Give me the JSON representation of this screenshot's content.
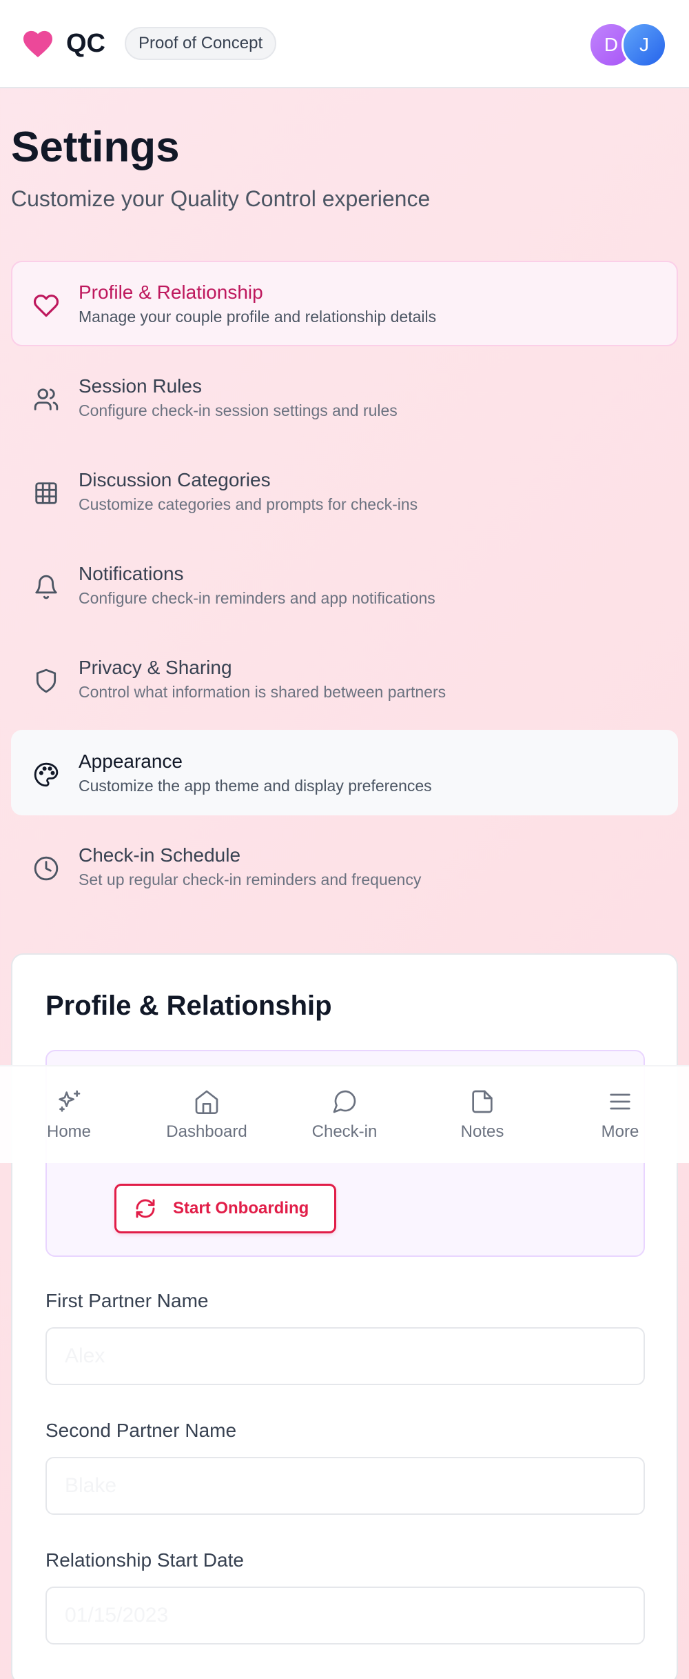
{
  "header": {
    "app_name": "QC",
    "badge": "Proof of Concept",
    "avatars": [
      "D",
      "J"
    ],
    "brand_color": "#ec4899"
  },
  "page": {
    "title": "Settings",
    "subtitle": "Customize your Quality Control experience"
  },
  "menu": [
    {
      "icon": "heart-icon",
      "title": "Profile & Relationship",
      "description": "Manage your couple profile and relationship details",
      "state": "active"
    },
    {
      "icon": "users-icon",
      "title": "Session Rules",
      "description": "Configure check-in session settings and rules"
    },
    {
      "icon": "grid-icon",
      "title": "Discussion Categories",
      "description": "Customize categories and prompts for check-ins"
    },
    {
      "icon": "bell-icon",
      "title": "Notifications",
      "description": "Configure check-in reminders and app notifications"
    },
    {
      "icon": "shield-icon",
      "title": "Privacy & Sharing",
      "description": "Control what information is shared between partners"
    },
    {
      "icon": "palette-icon",
      "title": "Appearance",
      "description": "Customize the app theme and display preferences",
      "state": "hover"
    },
    {
      "icon": "clock-icon",
      "title": "Check-in Schedule",
      "description": "Set up regular check-in reminders and frequency"
    }
  ],
  "profile_card": {
    "title": "Profile & Relationship",
    "onboarding_button": "Start Onboarding",
    "fields": {
      "first_partner": {
        "label": "First Partner Name",
        "placeholder": "Alex"
      },
      "second_partner": {
        "label": "Second Partner Name",
        "placeholder": "Blake"
      },
      "start_date": {
        "label": "Relationship Start Date",
        "placeholder": "01/15/2023"
      }
    }
  },
  "bottom_nav": [
    {
      "icon": "sparkles-icon",
      "label": "Home"
    },
    {
      "icon": "home-icon",
      "label": "Dashboard"
    },
    {
      "icon": "chat-icon",
      "label": "Check-in"
    },
    {
      "icon": "note-icon",
      "label": "Notes"
    },
    {
      "icon": "menu-icon",
      "label": "More"
    }
  ]
}
